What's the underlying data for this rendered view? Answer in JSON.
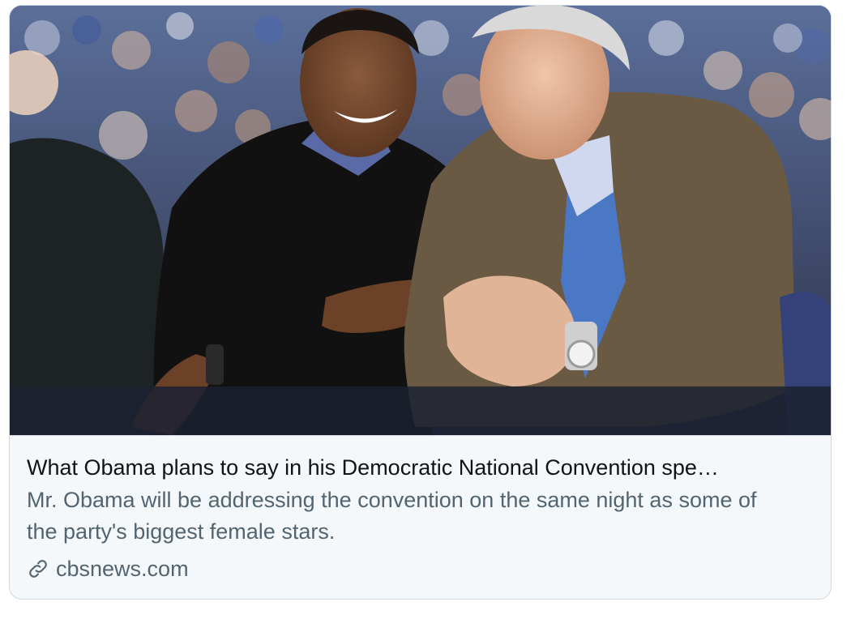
{
  "card": {
    "title": "What Obama plans to say in his Democratic National Convention spe…",
    "description": "Mr. Obama will be addressing the convention on the same night as some of the party's biggest female stars.",
    "domain": "cbsnews.com",
    "link_icon": "link-icon",
    "image_description": "photo-thumbnail"
  }
}
